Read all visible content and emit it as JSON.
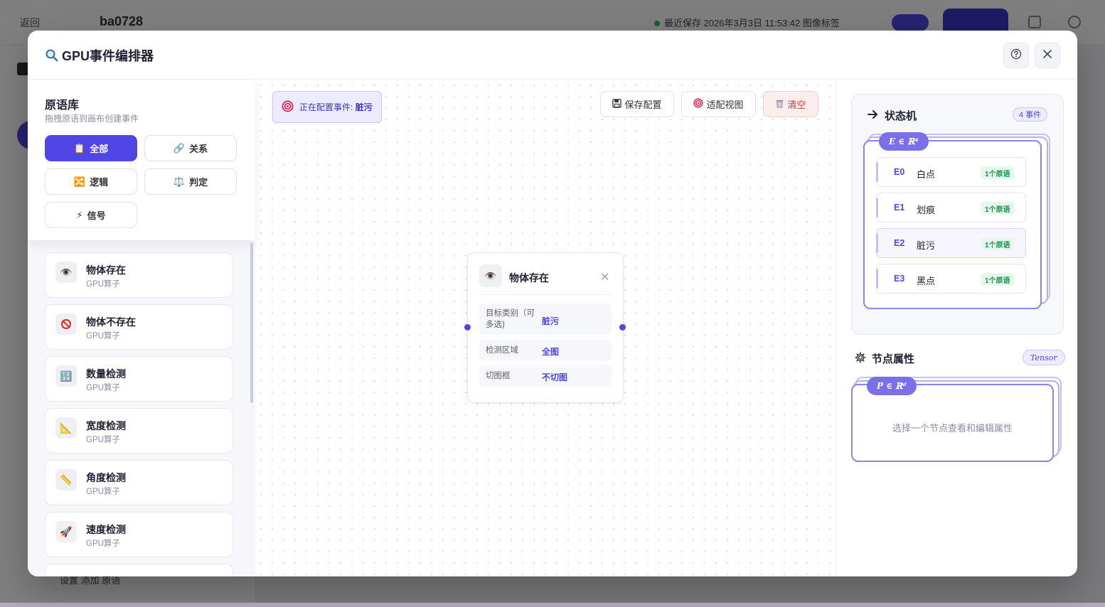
{
  "modal": {
    "title": "GPU事件编排器",
    "help_icon": "help-circle-icon",
    "close_icon": "close-icon"
  },
  "library": {
    "title": "原语库",
    "subtitle": "拖拽原语到画布创建事件",
    "filters": [
      {
        "label": "全部",
        "icon": "clipboard-icon",
        "active": true
      },
      {
        "label": "关系",
        "icon": "link-icon",
        "active": false
      },
      {
        "label": "逻辑",
        "icon": "shuffle-icon",
        "active": false
      },
      {
        "label": "判定",
        "icon": "scale-icon",
        "active": false
      },
      {
        "label": "信号",
        "icon": "lightning-icon",
        "active": false
      }
    ],
    "primitives": [
      {
        "name": "物体存在",
        "sub": "GPU算子",
        "icon": "eye-icon"
      },
      {
        "name": "物体不存在",
        "sub": "GPU算子",
        "icon": "prohibited-icon"
      },
      {
        "name": "数量检测",
        "sub": "GPU算子",
        "icon": "numbers-icon"
      },
      {
        "name": "宽度检测",
        "sub": "GPU算子",
        "icon": "triangle-ruler-icon"
      },
      {
        "name": "角度检测",
        "sub": "GPU算子",
        "icon": "ruler-icon"
      },
      {
        "name": "速度检测",
        "sub": "GPU算子",
        "icon": "rocket-icon"
      }
    ]
  },
  "canvas": {
    "config_prefix": "正在配置事件:",
    "config_event": "脏污",
    "toolbar": {
      "save": "保存配置",
      "fit": "适配视图",
      "clear": "清空"
    },
    "node": {
      "title": "物体存在",
      "icon": "eye-icon",
      "props": [
        {
          "key": "目标类别（可多选)",
          "value": "脏污"
        },
        {
          "key": "检测区域",
          "value": "全图"
        },
        {
          "key": "切图框",
          "value": "不切图"
        }
      ]
    }
  },
  "state_machine": {
    "title": "状态机",
    "count_badge": "4 事件",
    "math_label": "E ∈ ℝ⁴",
    "events": [
      {
        "id": "E0",
        "name": "白点",
        "tag": "1个原语",
        "selected": false
      },
      {
        "id": "E1",
        "name": "划痕",
        "tag": "1个原语",
        "selected": false
      },
      {
        "id": "E2",
        "name": "脏污",
        "tag": "1个原语",
        "selected": true
      },
      {
        "id": "E3",
        "name": "黑点",
        "tag": "1个原语",
        "selected": false
      }
    ]
  },
  "node_props": {
    "title": "节点属性",
    "badge": "Tensor",
    "math_label": "P ∈ ℝᵈ",
    "empty_text": "选择一个节点查看和编辑属性"
  },
  "background": {
    "back_label": "返回",
    "title": "ba0728",
    "status_text": "最近保存  2026年3月3日 11:53:42 图像标签",
    "footer": "设置  添加  原语"
  },
  "colors": {
    "accent": "#4f46e5",
    "danger": "#d93b3b",
    "success": "#17964a"
  }
}
